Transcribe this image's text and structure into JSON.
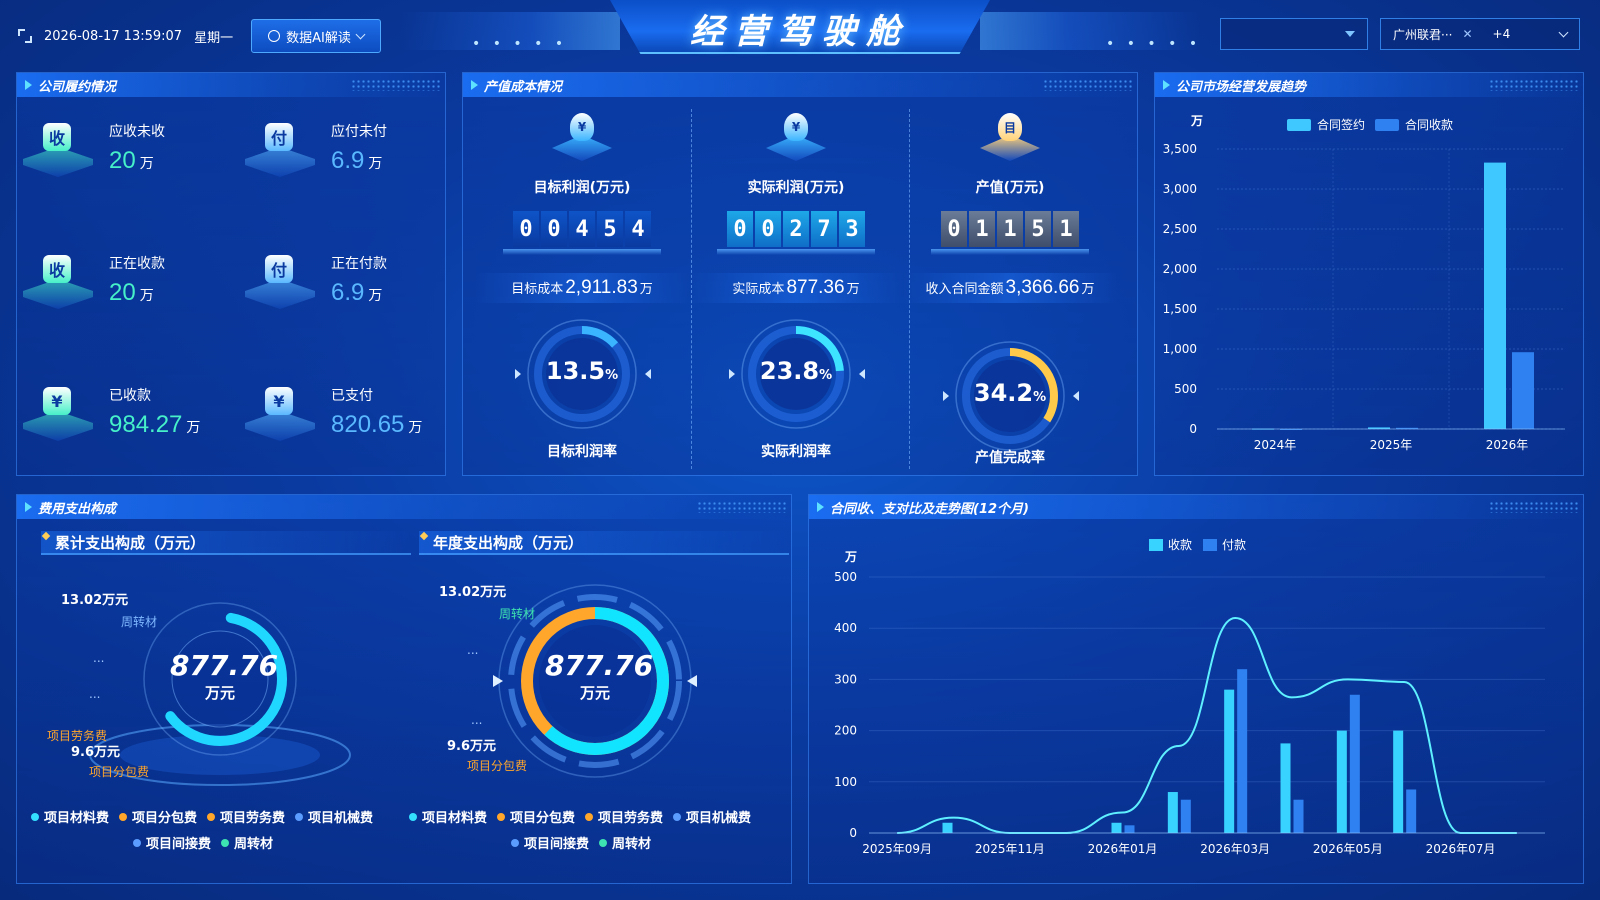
{
  "header": {
    "datetime": "2026-08-17 13:59:07",
    "weekday": "星期一",
    "ai_button": "数据AI解读",
    "title": "经营驾驶舱",
    "dots": "• • • • •",
    "dropdown1_value": "",
    "company_select": "广州联君···",
    "company_more": "+4"
  },
  "performance": {
    "title": "公司履约情况",
    "items": [
      {
        "label": "应收未收",
        "value": "20",
        "unit": "万",
        "glyph": "收"
      },
      {
        "label": "应付未付",
        "value": "6.9",
        "unit": "万",
        "glyph": "付"
      },
      {
        "label": "正在收款",
        "value": "20",
        "unit": "万",
        "glyph": "收"
      },
      {
        "label": "正在付款",
        "value": "6.9",
        "unit": "万",
        "glyph": "付"
      },
      {
        "label": "已收款",
        "value": "984.27",
        "unit": "万",
        "glyph": "¥"
      },
      {
        "label": "已支付",
        "value": "820.65",
        "unit": "万",
        "glyph": "¥"
      }
    ]
  },
  "cost": {
    "title": "产值成本情况",
    "cols": [
      {
        "label": "目标利润(万元)",
        "digits": [
          "0",
          "0",
          "4",
          "5",
          "4"
        ],
        "sub_label": "目标成本",
        "sub_value": "2,911.83",
        "sub_unit": "万",
        "rate": "13.5",
        "rate_unit": "%",
        "rate_fraction": 0.135,
        "rate_label": "目标利润率",
        "glyph": "¥"
      },
      {
        "label": "实际利润(万元)",
        "digits": [
          "0",
          "0",
          "2",
          "7",
          "3"
        ],
        "sub_label": "实际成本",
        "sub_value": "877.36",
        "sub_unit": "万",
        "rate": "23.8",
        "rate_unit": "%",
        "rate_fraction": 0.238,
        "rate_label": "实际利润率",
        "glyph": "¥"
      },
      {
        "label": "产值(万元)",
        "digits": [
          "0",
          "1",
          "1",
          "5",
          "1"
        ],
        "sub_label": "收入合同金额",
        "sub_value": "3,366.66",
        "sub_unit": "万",
        "rate": "34.2",
        "rate_unit": "%",
        "rate_fraction": 0.342,
        "rate_label": "产值完成率",
        "glyph": "目"
      }
    ]
  },
  "market": {
    "title": "公司市场经营发展趋势",
    "unit": "万",
    "legend": [
      "合同签约",
      "合同收款"
    ],
    "colors": [
      "#3ec8ff",
      "#2f80f0"
    ]
  },
  "expense": {
    "title": "费用支出构成",
    "cumulative_title": "累计支出构成（万元）",
    "annual_title": "年度支出构成（万元）",
    "total": "877.76",
    "total_unit": "万元",
    "anno_top_value": "13.02万元",
    "anno_top_name": "周转材",
    "anno_bottom_value": "9.6万元",
    "anno_bottom_name": "项目分包费",
    "anno_labor": "项目劳务费",
    "ellipsis": "...",
    "legend_row1": [
      "项目材料费",
      "项目分包费",
      "项目劳务费",
      "项目机械费"
    ],
    "legend_row2": [
      "项目间接费",
      "周转材"
    ],
    "legend_colors": [
      "#34e0ff",
      "#ffa62b",
      "#ffa62b",
      "#5a9cff",
      "#5a9cff",
      "#3de3b0"
    ]
  },
  "contract_trend": {
    "title": "合同收、支对比及走势图(12个月)",
    "unit": "万",
    "legend": [
      "收款",
      "付款"
    ]
  },
  "chart_data": [
    {
      "type": "bar",
      "title": "公司市场经营发展趋势",
      "ylabel": "万",
      "categories": [
        "2024年",
        "2025年",
        "2026年"
      ],
      "series": [
        {
          "name": "合同签约",
          "values": [
            5,
            20,
            3330
          ]
        },
        {
          "name": "合同收款",
          "values": [
            0,
            15,
            960
          ]
        }
      ],
      "ylim": [
        0,
        3500
      ],
      "yticks": [
        "0",
        "500",
        "1,000",
        "1,500",
        "2,000",
        "2,500",
        "3,000",
        "3,500"
      ],
      "grid": true,
      "legend": "top"
    },
    {
      "type": "bar",
      "title": "合同收、支对比及走势图(12个月)",
      "ylabel": "万",
      "categories": [
        "2025年09月",
        "2025年10月",
        "2025年11月",
        "2025年12月",
        "2026年01月",
        "2026年02月",
        "2026年03月",
        "2026年04月",
        "2026年05月",
        "2026年06月",
        "2026年07月",
        "2026年08月"
      ],
      "xtick_labels": [
        "2025年09月",
        "2025年11月",
        "2026年01月",
        "2026年03月",
        "2026年05月",
        "2026年07月"
      ],
      "series": [
        {
          "name": "收款",
          "values": [
            0,
            20,
            0,
            0,
            20,
            80,
            280,
            175,
            200,
            200,
            0,
            0
          ]
        },
        {
          "name": "付款",
          "values": [
            0,
            0,
            0,
            0,
            15,
            65,
            320,
            65,
            270,
            85,
            0,
            0
          ]
        }
      ],
      "trend_line": [
        0,
        30,
        0,
        0,
        40,
        170,
        420,
        265,
        300,
        295,
        0,
        0
      ],
      "ylim": [
        0,
        500
      ],
      "yticks": [
        "0",
        "100",
        "200",
        "300",
        "400",
        "500"
      ],
      "grid": true,
      "legend": "top"
    }
  ]
}
